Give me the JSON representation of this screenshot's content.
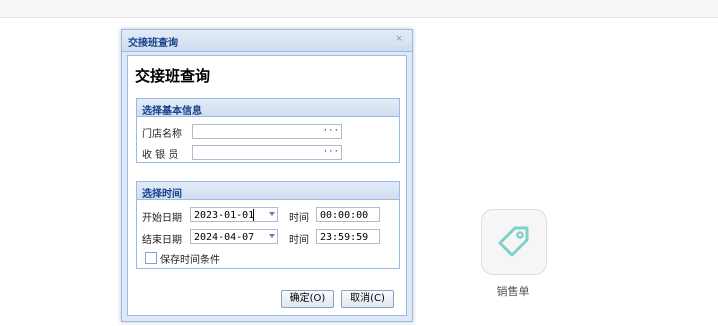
{
  "dialog": {
    "window_title": "交接班查询",
    "close_glyph": "⨯",
    "heading": "交接班查询",
    "basic_info": {
      "legend": "选择基本信息",
      "store_label": "门店名称",
      "store_value": "",
      "store_trigger": "···",
      "cashier_label": "收 银 员",
      "cashier_value": "",
      "cashier_trigger": "···"
    },
    "time_section": {
      "legend": "选择时间",
      "start_date_label": "开始日期",
      "start_date_value": "2023-01-01",
      "start_time_label": "时间",
      "start_time_value": "00:00:00",
      "end_date_label": "结束日期",
      "end_date_value": "2024-04-07",
      "end_time_label": "时间",
      "end_time_value": "23:59:59",
      "save_checkbox_label": "保存时间条件",
      "save_checked": false
    },
    "ok_button": "确定(O)",
    "cancel_button": "取消(C)"
  },
  "background": {
    "app_tile_label": "销售单",
    "app_tile_icon": "tag-icon",
    "accent_color": "#7fd0c6"
  }
}
